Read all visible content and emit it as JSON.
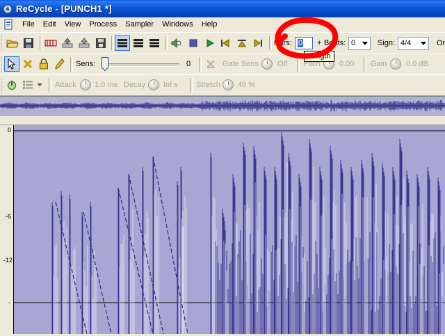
{
  "window": {
    "title": "ReCycle - [PUNCH1 *]",
    "app_icon": "recycle-app-icon"
  },
  "menu": {
    "items": [
      "File",
      "Edit",
      "View",
      "Process",
      "Sampler",
      "Windows",
      "Help"
    ]
  },
  "toolbar1": {
    "bars_label": "Bars:",
    "bars_value": "0",
    "plus_label": "+",
    "beats_label": "Beats:",
    "beats_value": "0",
    "sign_label": "Sign:",
    "sign_value": "4/4",
    "trailing_label": "Or",
    "tooltip": "Length"
  },
  "toolbar2": {
    "sens_label": "Sens:",
    "sens_value": "0",
    "sens_level": 0,
    "gate_sens_label": "Gate Sens",
    "gate_sens_value": "Off",
    "pitch_label": "Pitch",
    "pitch_value": "0.00",
    "gain_label": "Gain",
    "gain_value": "0.0 dB"
  },
  "toolbar3": {
    "attack_label": "Attack",
    "attack_value": "1.0 ms",
    "decay_label": "Decay",
    "decay_value": "Inf s",
    "stretch_label": "Stretch",
    "stretch_value": "40 %"
  },
  "waveform": {
    "db_scale": [
      "0",
      "-6",
      "-12",
      "-"
    ],
    "colors": {
      "background": "#a9a6d3",
      "wave": "#3a3890",
      "wave_light": "#ffffff",
      "overview_bg": "#b2b0d3"
    }
  },
  "annotation": {
    "circle_color": "#ff0000"
  }
}
